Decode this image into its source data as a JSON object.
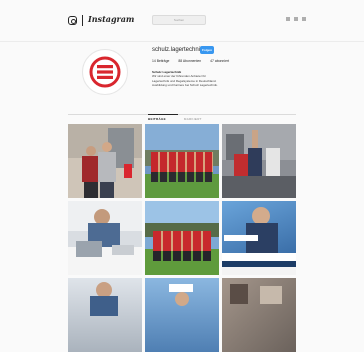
{
  "app": {
    "wordmark": "Instagram",
    "search_placeholder": "Suchen"
  },
  "profile": {
    "username": "schulz.lagertechnik",
    "follow_label": "Folgen",
    "stats": [
      "14 Beiträge",
      "88 Abonnenten",
      "47 abonniert"
    ],
    "bio_name": "Schulz Lagertechnik",
    "bio_lines": [
      "Wir sind einer der führenden Anbieter für",
      "Lagertechnik und Regalsysteme in Deutschland.",
      "Ausbildung und Karriere bei Schulz Lagertechnik."
    ]
  },
  "tabs": [
    "BEITRÄGE",
    "MARKIERT"
  ],
  "posts": [
    {
      "alt": "post-1"
    },
    {
      "alt": "post-2"
    },
    {
      "alt": "post-3"
    },
    {
      "alt": "post-4"
    },
    {
      "alt": "post-5"
    },
    {
      "alt": "post-6"
    },
    {
      "alt": "post-7"
    },
    {
      "alt": "post-8"
    },
    {
      "alt": "post-9"
    }
  ],
  "colors": {
    "brand_red": "#d9262e",
    "follow_blue": "#3897f0",
    "background": "#fafafa"
  }
}
